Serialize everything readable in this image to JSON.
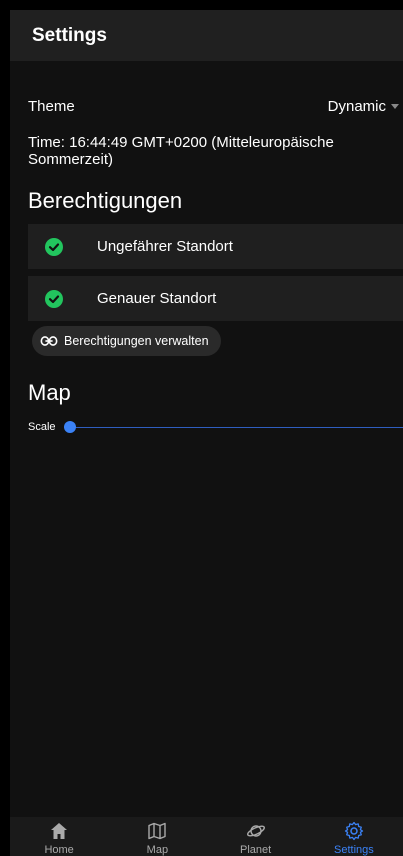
{
  "header": {
    "title": "Settings"
  },
  "theme": {
    "label": "Theme",
    "value": "Dynamic"
  },
  "time_text": "Time: 16:44:49 GMT+0200 (Mitteleuropäische Sommerzeit)",
  "permissions": {
    "heading": "Berechtigungen",
    "items": [
      {
        "label": "Ungefährer Standort",
        "status": "granted",
        "icon": "check-circle-icon"
      },
      {
        "label": "Genauer Standort",
        "status": "granted",
        "icon": "check-circle-icon"
      }
    ],
    "manage_label": "Berechtigungen verwalten"
  },
  "map": {
    "heading": "Map",
    "scale_label": "Scale",
    "scale_value": 0.0
  },
  "nav": {
    "items": [
      {
        "label": "Home",
        "icon": "home-icon"
      },
      {
        "label": "Map",
        "icon": "map-icon"
      },
      {
        "label": "Planet",
        "icon": "planet-icon"
      },
      {
        "label": "Settings",
        "icon": "gear-icon"
      }
    ],
    "active": "Settings"
  },
  "colors": {
    "accent": "#3b82f6",
    "success": "#22c55e",
    "surface": "#1f1f1f",
    "background": "#111111"
  }
}
